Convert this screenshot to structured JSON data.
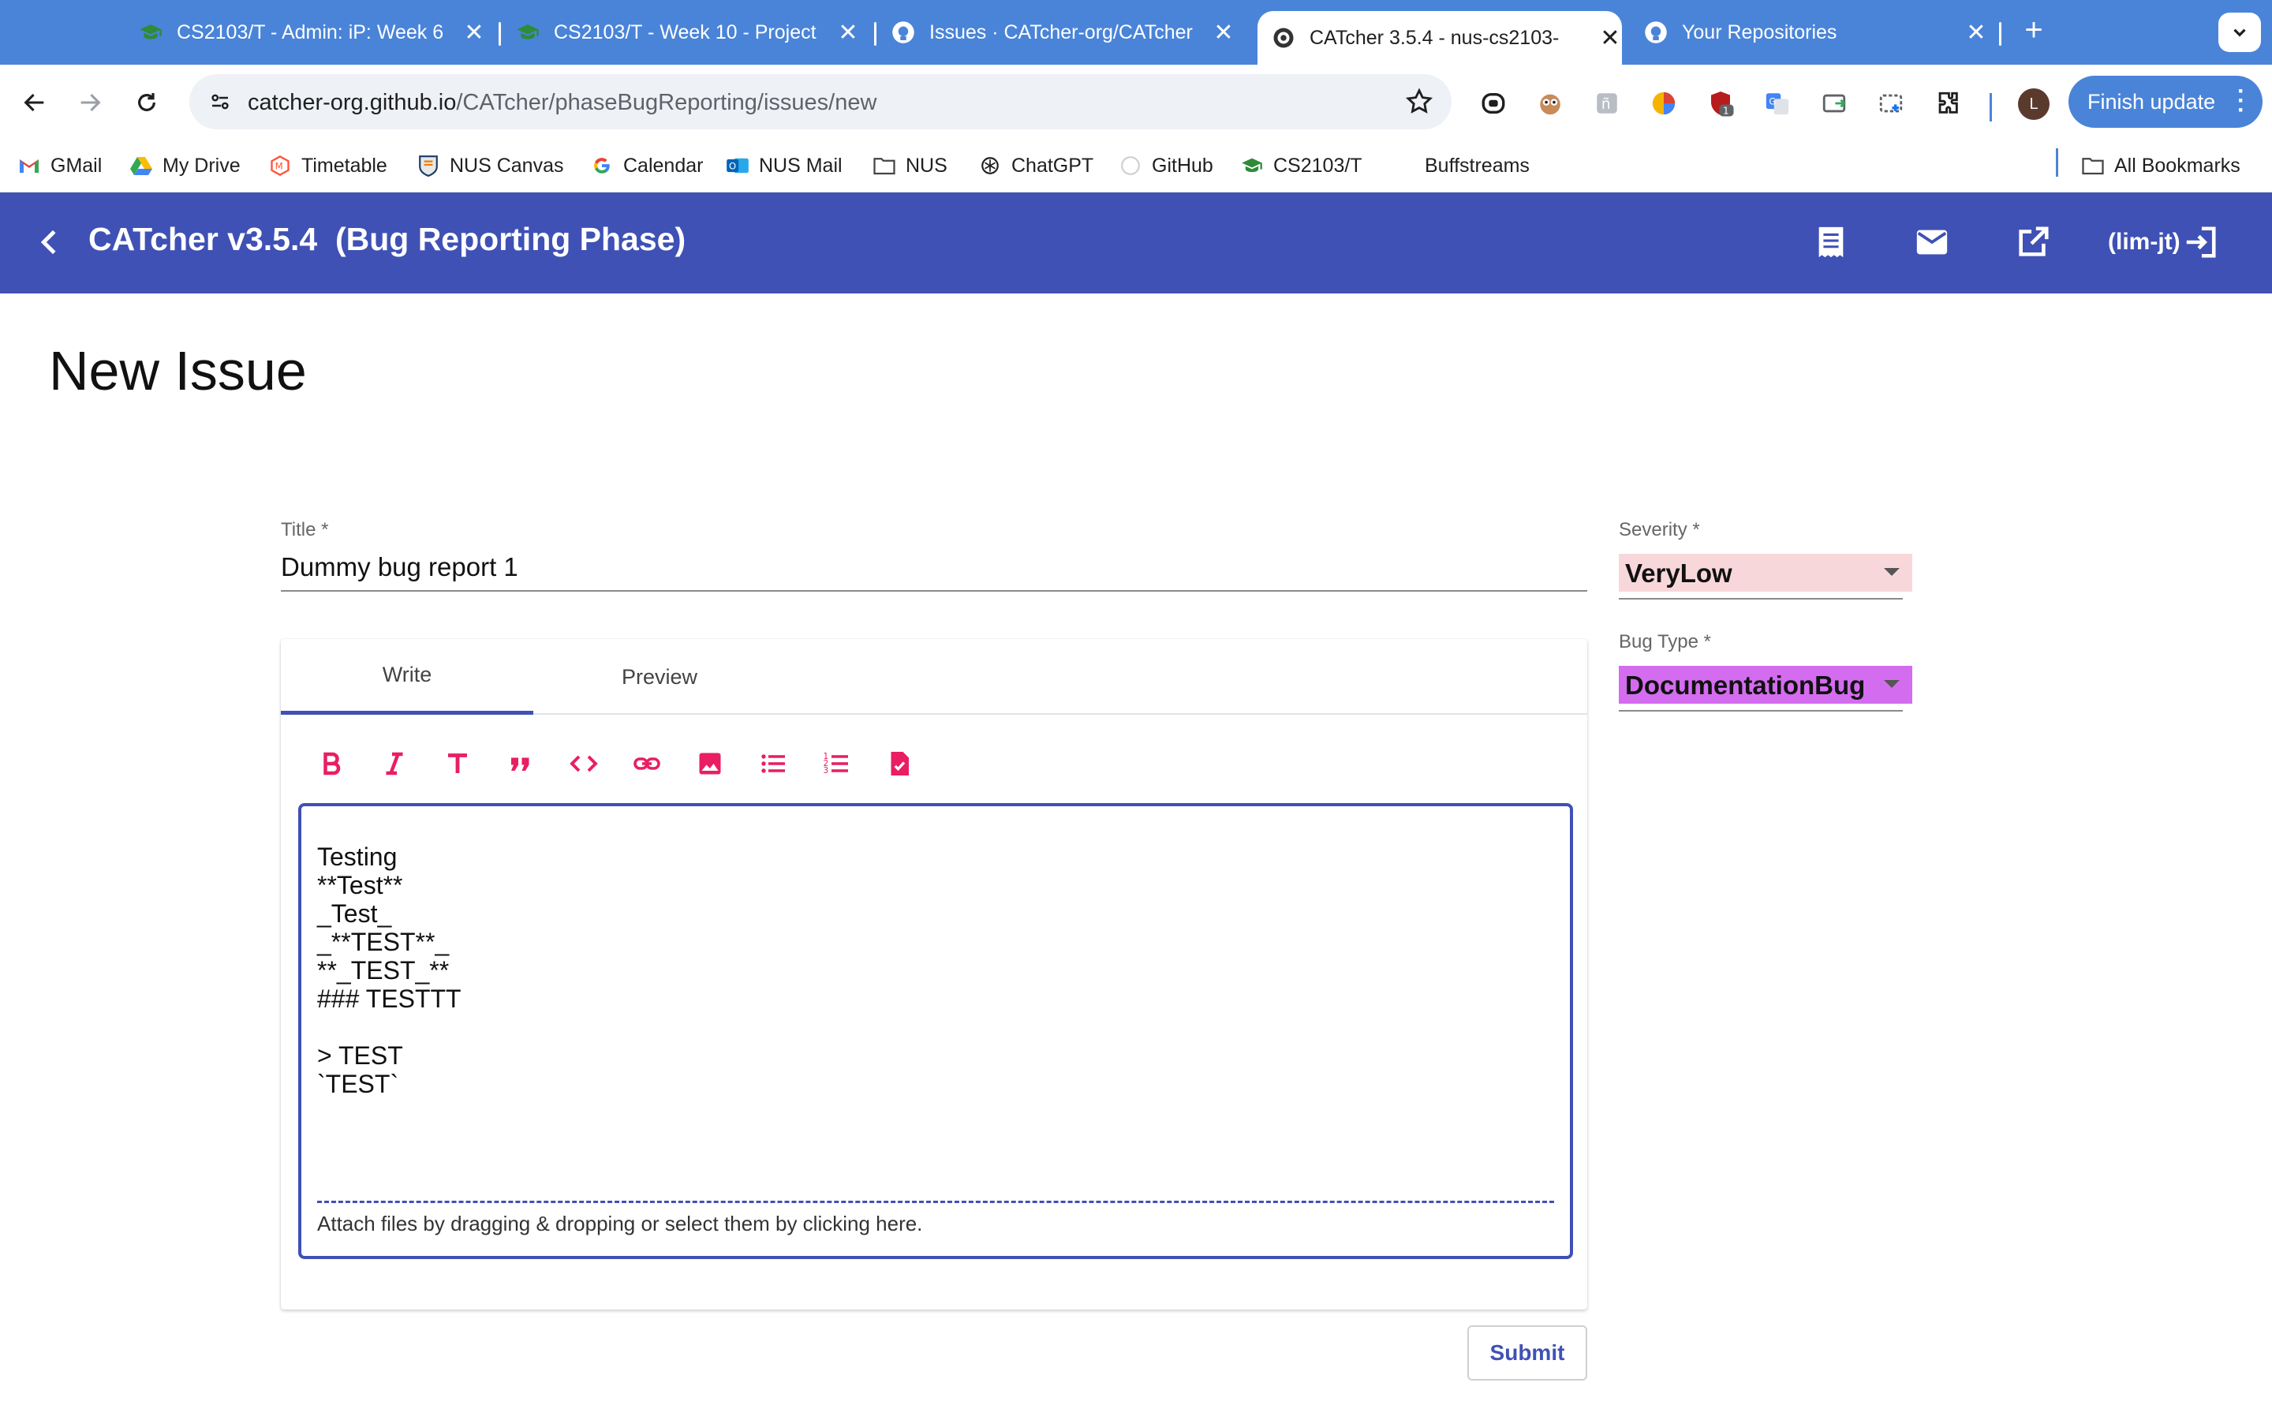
{
  "browser": {
    "tabs": [
      {
        "title": "CS2103/T - Admin: iP: Week 6",
        "icon": "graduation-cap-icon"
      },
      {
        "title": "CS2103/T - Week 10 - Project",
        "icon": "graduation-cap-icon"
      },
      {
        "title": "Issues · CATcher-org/CATcher",
        "icon": "github-icon"
      },
      {
        "title": "CATcher 3.5.4 - nus-cs2103-",
        "icon": "catcher-icon",
        "active": true
      },
      {
        "title": "Your Repositories",
        "icon": "github-icon"
      }
    ],
    "url_host": "catcher-org.github.io",
    "url_path": "/CATcher/phaseBugReporting/issues/new",
    "profile_initial": "L",
    "finish_update_label": "Finish update",
    "extension_badge": "1",
    "bookmarks": [
      {
        "label": "GMail",
        "icon": "gmail-icon"
      },
      {
        "label": "My Drive",
        "icon": "drive-icon"
      },
      {
        "label": "Timetable",
        "icon": "timetable-icon"
      },
      {
        "label": "NUS Canvas",
        "icon": "canvas-icon"
      },
      {
        "label": "Calendar",
        "icon": "google-icon"
      },
      {
        "label": "NUS Mail",
        "icon": "outlook-icon"
      },
      {
        "label": "NUS",
        "icon": "folder-icon"
      },
      {
        "label": "ChatGPT",
        "icon": "chatgpt-icon"
      },
      {
        "label": "GitHub",
        "icon": "github-icon"
      },
      {
        "label": "CS2103/T",
        "icon": "graduation-cap-icon"
      },
      {
        "label": "Buffstreams",
        "icon": ""
      }
    ],
    "all_bookmarks_label": "All Bookmarks"
  },
  "app": {
    "title": "CATcher v3.5.4  (Bug Reporting Phase)",
    "user": "(lim-jt)",
    "accent": "#3f51b5",
    "icon_accent": "#e91e63"
  },
  "form": {
    "page_title": "New Issue",
    "title_label": "Title *",
    "title_value": "Dummy bug report 1",
    "tabs": [
      "Write",
      "Preview"
    ],
    "body_lines": "Testing\n**Test**\n_Test_\n_**TEST**_\n**_TEST_**\n### TESTTT\n\n> TEST\n`TEST`",
    "attach_hint": "Attach files by dragging & dropping or select them by clicking here.",
    "severity_label": "Severity *",
    "severity_value": "VeryLow",
    "severity_color": "#f8d7da",
    "bug_type_label": "Bug Type *",
    "bug_type_value": "DocumentationBug",
    "bug_type_color": "#d46cf0",
    "submit_label": "Submit"
  }
}
